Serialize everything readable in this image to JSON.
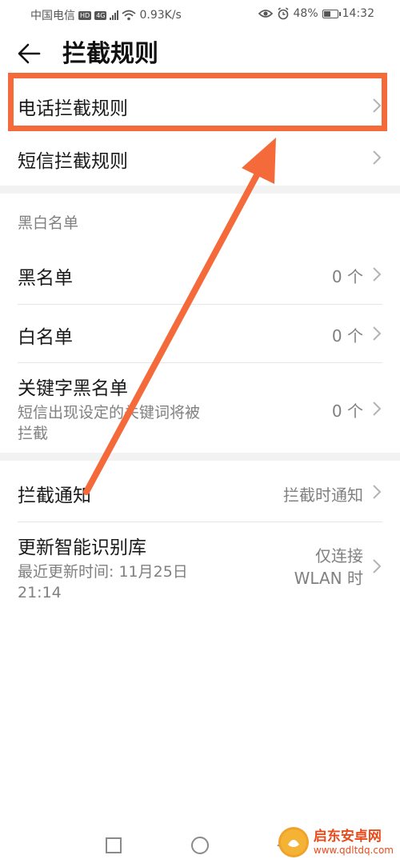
{
  "status_bar": {
    "carrier": "中国电信",
    "hd_badge": "HD",
    "net_badge": "4G",
    "speed": "0.93K/s",
    "battery": "48%",
    "time": "14:32"
  },
  "header": {
    "title": "拦截规则",
    "back_icon": "arrow-left-icon"
  },
  "rules": [
    {
      "label": "电话拦截规则"
    },
    {
      "label": "短信拦截规则"
    }
  ],
  "blackwhite": {
    "section_title": "黑白名单",
    "items": [
      {
        "label": "黑名单",
        "value": "0 个"
      },
      {
        "label": "白名单",
        "value": "0 个"
      },
      {
        "label": "关键字黑名单",
        "sub_line1": "短信出现设定的关键词将被",
        "sub_line2": "拦截",
        "value": "0 个"
      }
    ]
  },
  "other": {
    "notify": {
      "label": "拦截通知",
      "value": "拦截时通知"
    },
    "update": {
      "label": "更新智能识别库",
      "sub_line1": "最近更新时间: 11月25日",
      "sub_line2": "21:14",
      "value_line1": "仅连接",
      "value_line2": "WLAN 时"
    }
  },
  "watermark": {
    "name": "启东安卓网",
    "url": "www.qdltdq.com"
  },
  "colors": {
    "annotation": "#f46a3a",
    "secondary_text": "#808080",
    "section_gap": "#f2f2f2"
  }
}
